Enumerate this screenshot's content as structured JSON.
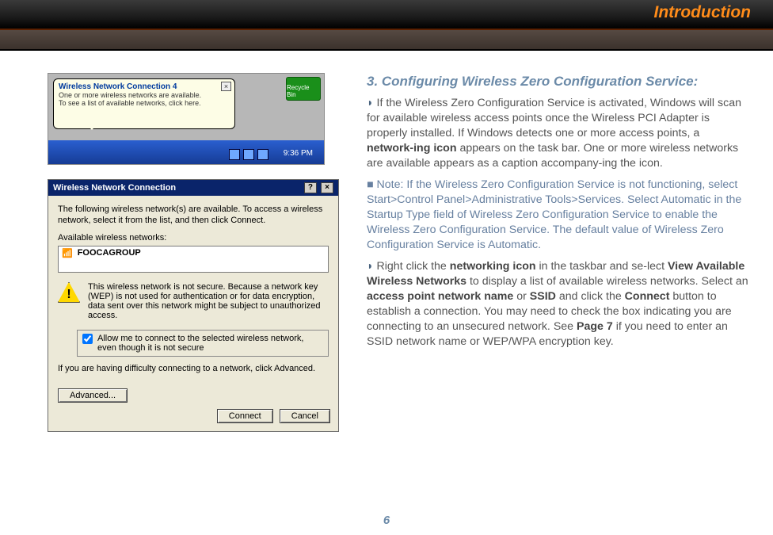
{
  "header": {
    "title": "Introduction"
  },
  "balloon": {
    "title": "Wireless Network Connection 4",
    "line1": "One or more wireless networks are available.",
    "line2": "To see a list of available networks, click here.",
    "recycle": "Recycle Bin",
    "clock": "9:36 PM"
  },
  "dialog": {
    "title": "Wireless Network Connection",
    "intro": "The following wireless network(s) are available. To access a wireless network, select it from the list, and then click Connect.",
    "avail_label": "Available wireless networks:",
    "ssid": "FOOCAGROUP",
    "warn": "This wireless network is not secure. Because a network key (WEP) is not used for authentication or for data encryption, data sent over this network might be subject to unauthorized access.",
    "allow": "Allow me to connect to the selected wireless network, even though it is not secure",
    "difficulty": "If you are having difficulty connecting to a network, click Advanced.",
    "btn_adv": "Advanced...",
    "btn_connect": "Connect",
    "btn_cancel": "Cancel",
    "help_q": "?",
    "close_x": "×"
  },
  "section": {
    "heading": "3. Configuring Wireless Zero Configuration Service:",
    "p1_a": "If the Wireless Zero Configuration Service is activated, Windows will scan for available wireless access points once the Wireless PCI Adapter is properly installed. If Windows detects one or more access points, a ",
    "p1_bold1": "network-ing icon",
    "p1_b": " appears on the task bar.  One or more wireless networks are available appears as a caption accompany-ing the icon.",
    "note": "Note: If the Wireless Zero Configuration Service is not functioning, select Start>Control Panel>Administrative Tools>Services. Select Automatic in the Startup Type field of Wireless Zero Configuration Service to enable the Wireless Zero Configuration Service. The default value of Wireless Zero Configuration Service is Automatic.",
    "p2_a": "Right click the ",
    "p2_bold1": "networking icon",
    "p2_b": " in the taskbar and se-lect ",
    "p2_bold2": "View Available Wireless Networks",
    "p2_c": " to display a list of available wireless networks.  Select an ",
    "p2_bold3": "access point network name",
    "p2_d": " or ",
    "p2_bold4": "SSID",
    "p2_e": " and click the ",
    "p2_bold5": "Connect",
    "p2_f": " button to establish a connection.  You may need to check the box indicating you are connecting to an unsecured network.  See ",
    "p2_bold6": "Page 7",
    "p2_g": " if you need to enter an SSID network name or WEP/WPA encryption key."
  },
  "page_number": "6"
}
